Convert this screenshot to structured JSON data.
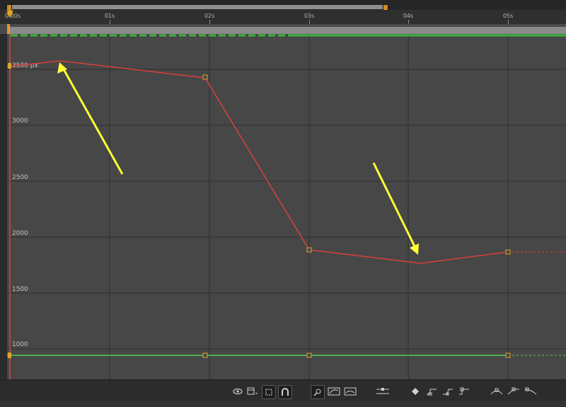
{
  "timeline": {
    "time_labels": [
      "0:00s",
      "01s",
      "02s",
      "03s",
      "04s",
      "05s"
    ]
  },
  "graph": {
    "unit_label": "3500 px",
    "value_labels": [
      "3000",
      "2500",
      "2000",
      "1500",
      "1000"
    ]
  },
  "colors": {
    "speed_curve": "#d9413b",
    "flat_curve": "#4fd24a",
    "keyframe": "#e0a528",
    "annotation_arrow": "#ffff33",
    "playhead": "#d9413b"
  },
  "toolbar": {
    "icons": [
      "eye-icon",
      "graph-type-menu-icon",
      "transform-box-icon",
      "snap-icon",
      "fit-selection-icon",
      "fit-all-icon",
      "fit-width-icon",
      "separate-dimensions-icon",
      "edit-keyframe-icon",
      "convert-hold-icon",
      "convert-auto-bezier-icon",
      "easy-ease-icon",
      "easy-ease-in-icon",
      "easy-ease-out-icon"
    ]
  }
}
